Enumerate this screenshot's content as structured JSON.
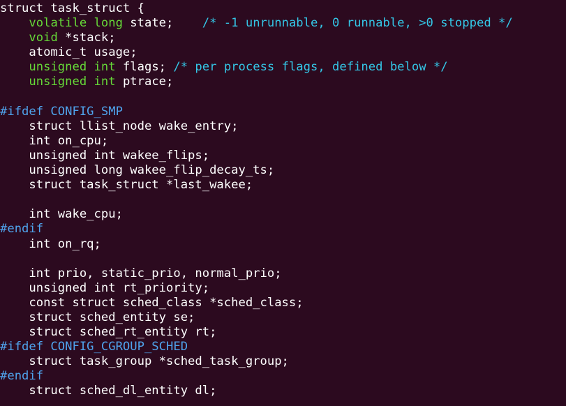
{
  "lines": [
    [
      [
        "struct task_struct {",
        "default"
      ]
    ],
    [
      [
        "    ",
        "default"
      ],
      [
        "volatile long",
        "type"
      ],
      [
        " state;    ",
        "default"
      ],
      [
        "/* -1 unrunnable, 0 runnable, >0 stopped */",
        "comment"
      ]
    ],
    [
      [
        "    ",
        "default"
      ],
      [
        "void",
        "type"
      ],
      [
        " *stack;",
        "default"
      ]
    ],
    [
      [
        "    atomic_t usage;",
        "default"
      ]
    ],
    [
      [
        "    ",
        "default"
      ],
      [
        "unsigned int",
        "type"
      ],
      [
        " flags; ",
        "default"
      ],
      [
        "/* per process flags, defined below */",
        "comment"
      ]
    ],
    [
      [
        "    ",
        "default"
      ],
      [
        "unsigned int",
        "type"
      ],
      [
        " ptrace;",
        "default"
      ]
    ],
    [
      [
        "",
        "default"
      ]
    ],
    [
      [
        "#ifdef CONFIG_SMP",
        "prep"
      ]
    ],
    [
      [
        "    struct llist_node wake_entry;",
        "default"
      ]
    ],
    [
      [
        "    int on_cpu;",
        "default"
      ]
    ],
    [
      [
        "    unsigned int wakee_flips;",
        "default"
      ]
    ],
    [
      [
        "    unsigned long wakee_flip_decay_ts;",
        "default"
      ]
    ],
    [
      [
        "    struct task_struct *last_wakee;",
        "default"
      ]
    ],
    [
      [
        "",
        "default"
      ]
    ],
    [
      [
        "    int wake_cpu;",
        "default"
      ]
    ],
    [
      [
        "#endif",
        "prep"
      ]
    ],
    [
      [
        "    int on_rq;",
        "default"
      ]
    ],
    [
      [
        "",
        "default"
      ]
    ],
    [
      [
        "    int prio, static_prio, normal_prio;",
        "default"
      ]
    ],
    [
      [
        "    unsigned int rt_priority;",
        "default"
      ]
    ],
    [
      [
        "    const struct sched_class *sched_class;",
        "default"
      ]
    ],
    [
      [
        "    struct sched_entity se;",
        "default"
      ]
    ],
    [
      [
        "    struct sched_rt_entity rt;",
        "default"
      ]
    ],
    [
      [
        "#ifdef CONFIG_CGROUP_SCHED",
        "prep"
      ]
    ],
    [
      [
        "    struct task_group *sched_task_group;",
        "default"
      ]
    ],
    [
      [
        "#endif",
        "prep"
      ]
    ],
    [
      [
        "    struct sched_dl_entity dl;",
        "default"
      ]
    ]
  ],
  "colors": {
    "background": "#2c0a1f",
    "default": "#ffffff",
    "type": "#66d938",
    "prep": "#4fa3ec",
    "comment": "#34c6e6"
  }
}
